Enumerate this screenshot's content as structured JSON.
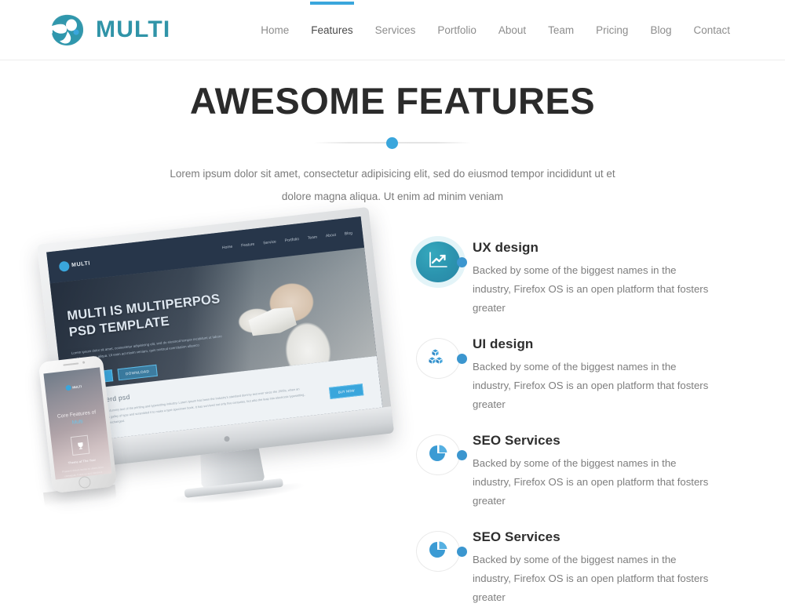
{
  "header": {
    "brand": {
      "text": "MULTI",
      "icon": "bird-swoosh-logo-icon",
      "color": "#3094a8"
    },
    "nav": [
      {
        "label": "Home",
        "active": false
      },
      {
        "label": "Features",
        "active": true
      },
      {
        "label": "Services",
        "active": false
      },
      {
        "label": "Portfolio",
        "active": false
      },
      {
        "label": "About",
        "active": false
      },
      {
        "label": "Team",
        "active": false
      },
      {
        "label": "Pricing",
        "active": false
      },
      {
        "label": "Blog",
        "active": false
      },
      {
        "label": "Contact",
        "active": false
      }
    ],
    "active_indicator_color": "#3aa6dc"
  },
  "hero": {
    "title": "AWESOME FEATURES",
    "subtitle_line1": "Lorem ipsum dolor sit amet, consectetur adipisicing elit, sed do eiusmod tempor incididunt ut",
    "subtitle_line2": "et dolore magna aliqua. Ut enim ad minim veniam",
    "divider_dot_color": "#3aa6dc"
  },
  "mockup": {
    "monitor": {
      "site_logo": "MULTI",
      "site_nav": [
        "Home",
        "Feature",
        "Service",
        "Portfolio",
        "Team",
        "About",
        "Blog"
      ],
      "hero_title": "MULTI IS MULTIPERPOS PSD TEMPLATE",
      "hero_body": "Lorem ipsum dolor sit amet, consectetur adipisicing elit, sed do eiusmod tempor incididunt ut labore et dolore magna aliqua. Ut enim ad minim veniam, quis nostrud exercitation ullamco",
      "hero_button_primary": "PURCHASE",
      "hero_button_secondary": "DOWNLOAD",
      "section_title": "100% layerd psd",
      "section_body": "Lorem Ipsum is simply dummy text of the printing and typesetting industry. Lorem Ipsum has been the industry's standard dummy text ever since the 1500s, when an unknown printer took a galley of type and scrambled it to make a type specimen book. It has survived not only five centuries, but also the leap into electronic typesetting, remaining essentially unchanged.",
      "section_button": "BUY NOW"
    },
    "phone": {
      "logo": "MULTI",
      "title_line1": "Core Features of",
      "title_line2": "Multi",
      "badge_icon": "trophy-icon",
      "subtitle": "Theme of The Year",
      "body": "Praesent dictum lacinia ex ullamcorper consequat. Fusce eu quis hendrerit magna hendrerit semper tellus consectetur mollis tortor laoreet lobortis."
    }
  },
  "features": [
    {
      "title": "UX design",
      "desc_line1": "Backed by some of the biggest names in the industry,",
      "desc_line2": "Firefox OS is an open platform that fosters greater",
      "icon": "line-chart-growth-icon",
      "style": "filled"
    },
    {
      "title": "UI design",
      "desc_line1": "Backed by some of the biggest names in the industry,",
      "desc_line2": "Firefox OS is an open platform that fosters greater",
      "icon": "stacked-cubes-icon",
      "style": "outline"
    },
    {
      "title": "SEO Services",
      "desc_line1": "Backed by some of the biggest names in the industry,",
      "desc_line2": "Firefox OS is an open platform that fosters greater",
      "icon": "pie-chart-icon",
      "style": "outline"
    },
    {
      "title": "SEO Services",
      "desc_line1": "Backed by some of the biggest names in the industry,",
      "desc_line2": "Firefox OS is an open platform that fosters greater",
      "icon": "pie-chart-icon",
      "style": "outline"
    }
  ],
  "colors": {
    "accent_blue": "#3aa6dc",
    "brand_teal": "#3094a8",
    "icon_fill_teal": "#2b93ae",
    "heading": "#2b2b2b",
    "body_text": "#7b7b7b"
  }
}
